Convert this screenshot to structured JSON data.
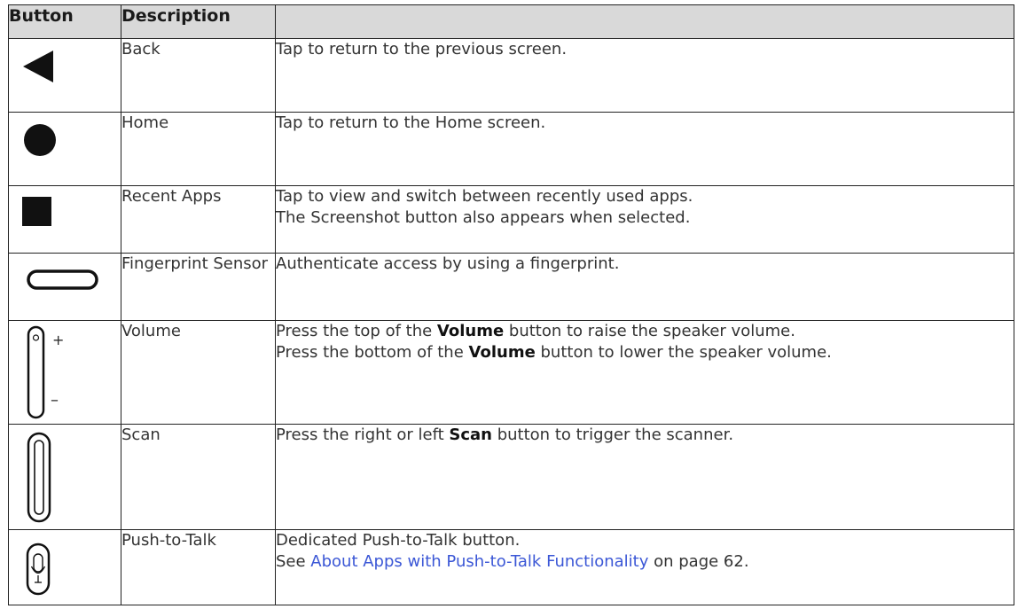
{
  "table": {
    "headers": {
      "button": "Button",
      "description": "Description"
    },
    "rows": [
      {
        "icon": "back-triangle-icon",
        "name": "Back",
        "lines": [
          "Tap to return to the previous screen."
        ]
      },
      {
        "icon": "home-circle-icon",
        "name": "Home",
        "lines": [
          "Tap to return to the Home screen."
        ]
      },
      {
        "icon": "recent-apps-square-icon",
        "name": "Recent Apps",
        "lines": [
          "Tap to view and switch between recently used apps.",
          "The Screenshot button also appears when selected."
        ]
      },
      {
        "icon": "fingerprint-sensor-icon",
        "name": "Fingerprint Sensor",
        "lines": [
          "Authenticate access by using a fingerprint."
        ]
      },
      {
        "icon": "volume-button-icon",
        "name": "Volume",
        "icon_plus": "+",
        "icon_minus": "–",
        "line1": {
          "before": "Press the top of the ",
          "bold": "Volume",
          "after": " button to raise the speaker volume."
        },
        "line2": {
          "before": "Press the bottom of the ",
          "bold": "Volume",
          "after": " button to lower the speaker volume."
        }
      },
      {
        "icon": "scan-button-icon",
        "name": "Scan",
        "line1": {
          "before": "Press the right or left ",
          "bold": "Scan",
          "after": " button to trigger the scanner."
        }
      },
      {
        "icon": "push-to-talk-button-icon",
        "name": "Push-to-Talk",
        "lines": [
          "Dedicated Push-to-Talk button."
        ],
        "see": {
          "before": "See ",
          "link": "About Apps with Push-to-Talk Functionality",
          "after": " on page 62."
        }
      }
    ]
  }
}
